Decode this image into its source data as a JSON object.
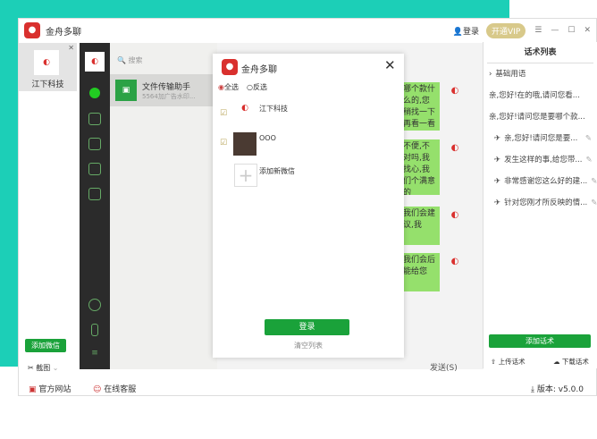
{
  "app": {
    "title": "金舟多聊",
    "login": "登录",
    "vip": "开通VIP"
  },
  "accounts": [
    {
      "name": "江下科技"
    }
  ],
  "left": {
    "add_wechat": "添加微信",
    "screenshot": "截图"
  },
  "chat": {
    "search_placeholder": "搜索",
    "item": {
      "name": "文件传输助手",
      "preview": "5564加广告水印..."
    },
    "send": "发送(S)",
    "bubbles": [
      "哪个款什么的,您稍找一下再看一看宝贝",
      "不便,不对吗,我找心,我们个满意的",
      "我们会建议,我",
      "我们会后能给您"
    ]
  },
  "modal": {
    "title": "金舟多聊",
    "select_all": "全选",
    "invert": "反选",
    "accounts": [
      {
        "name": "江下科技"
      },
      {
        "name": "OOO"
      }
    ],
    "add_new": "添加新微信",
    "login": "登录",
    "clear": "清空列表"
  },
  "right": {
    "title": "话术列表",
    "group": "基础用语",
    "items": [
      "亲,您好!在的哦,请问您看...",
      "亲,您好!请问您是要哪个款..."
    ],
    "sub_items": [
      "亲,您好!请问您是要...",
      "发生这样的事,给您带...",
      "非常感谢您这么好的建...",
      "针对您刚才所反映的情..."
    ],
    "add": "添加话术",
    "upload": "上传话术",
    "download": "下载话术"
  },
  "footer": {
    "website": "官方网站",
    "service": "在线客服",
    "version": "版本: v5.0.0"
  }
}
